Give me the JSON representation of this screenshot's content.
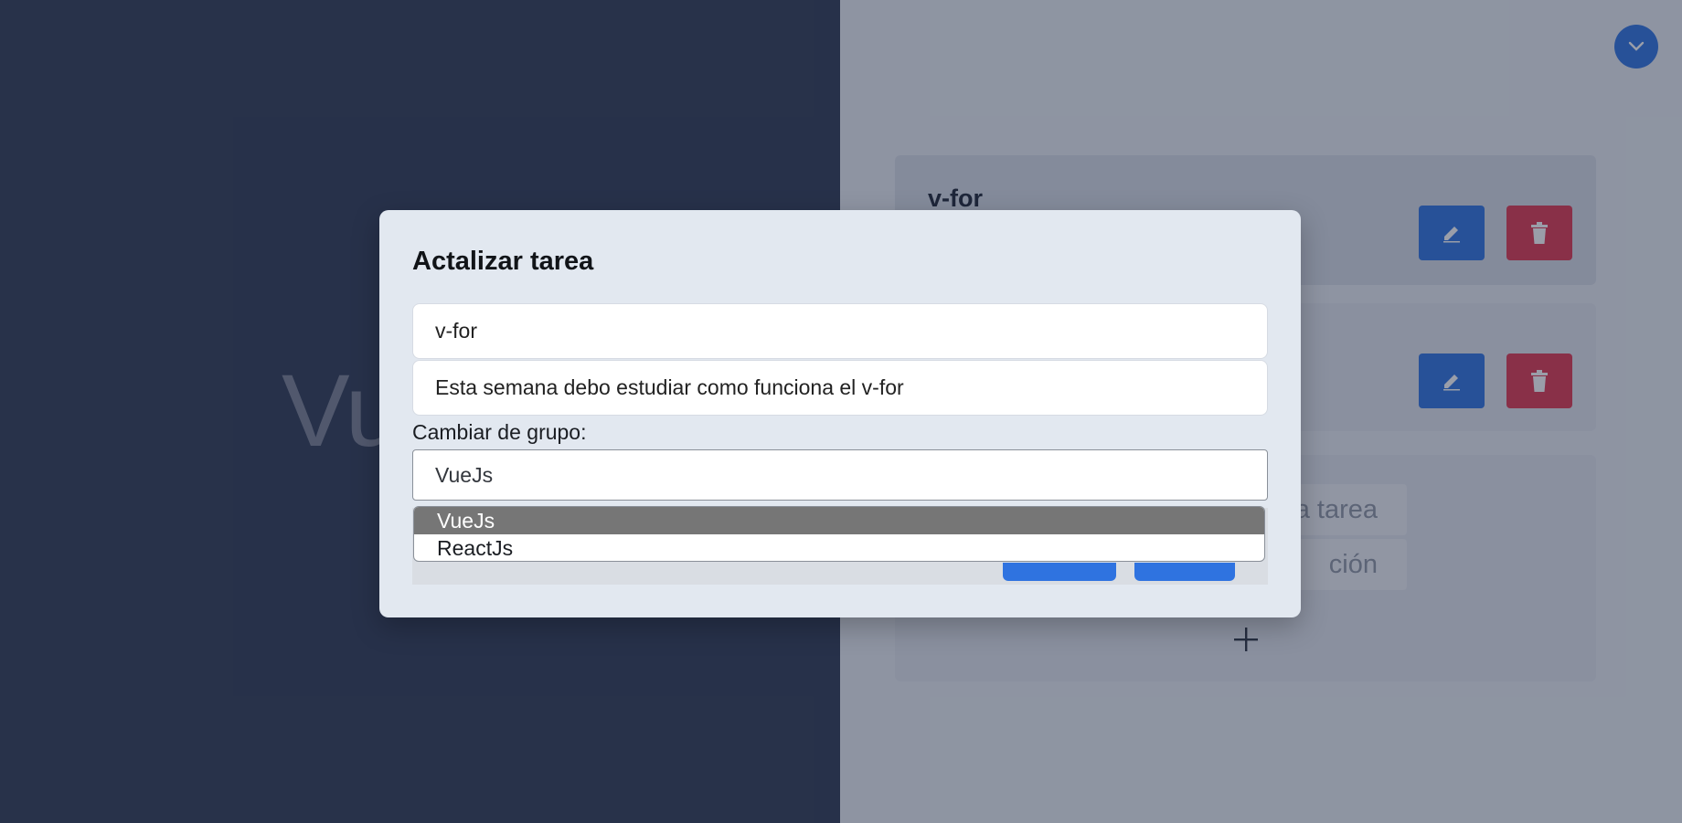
{
  "background": {
    "hero_title": "Vu",
    "cards": [
      {
        "title": "v-for"
      },
      {
        "title": ""
      }
    ],
    "ghost_inputs": [
      "la tarea",
      "ción"
    ],
    "colors": {
      "edit": "#2f73e0",
      "delete": "#e0374f",
      "left_panel": "#2f3a52"
    }
  },
  "modal": {
    "title": "Actalizar tarea",
    "title_value": "v-for",
    "description_value": "Esta semana debo estudiar como funciona el v-for",
    "group_label": "Cambiar de grupo:",
    "group_selected": "VueJs",
    "group_options": [
      "VueJs",
      "ReactJs"
    ]
  },
  "icons": {
    "avatar": "chevron-down-icon",
    "edit": "edit-icon",
    "delete": "trash-icon",
    "add": "plus-icon"
  }
}
